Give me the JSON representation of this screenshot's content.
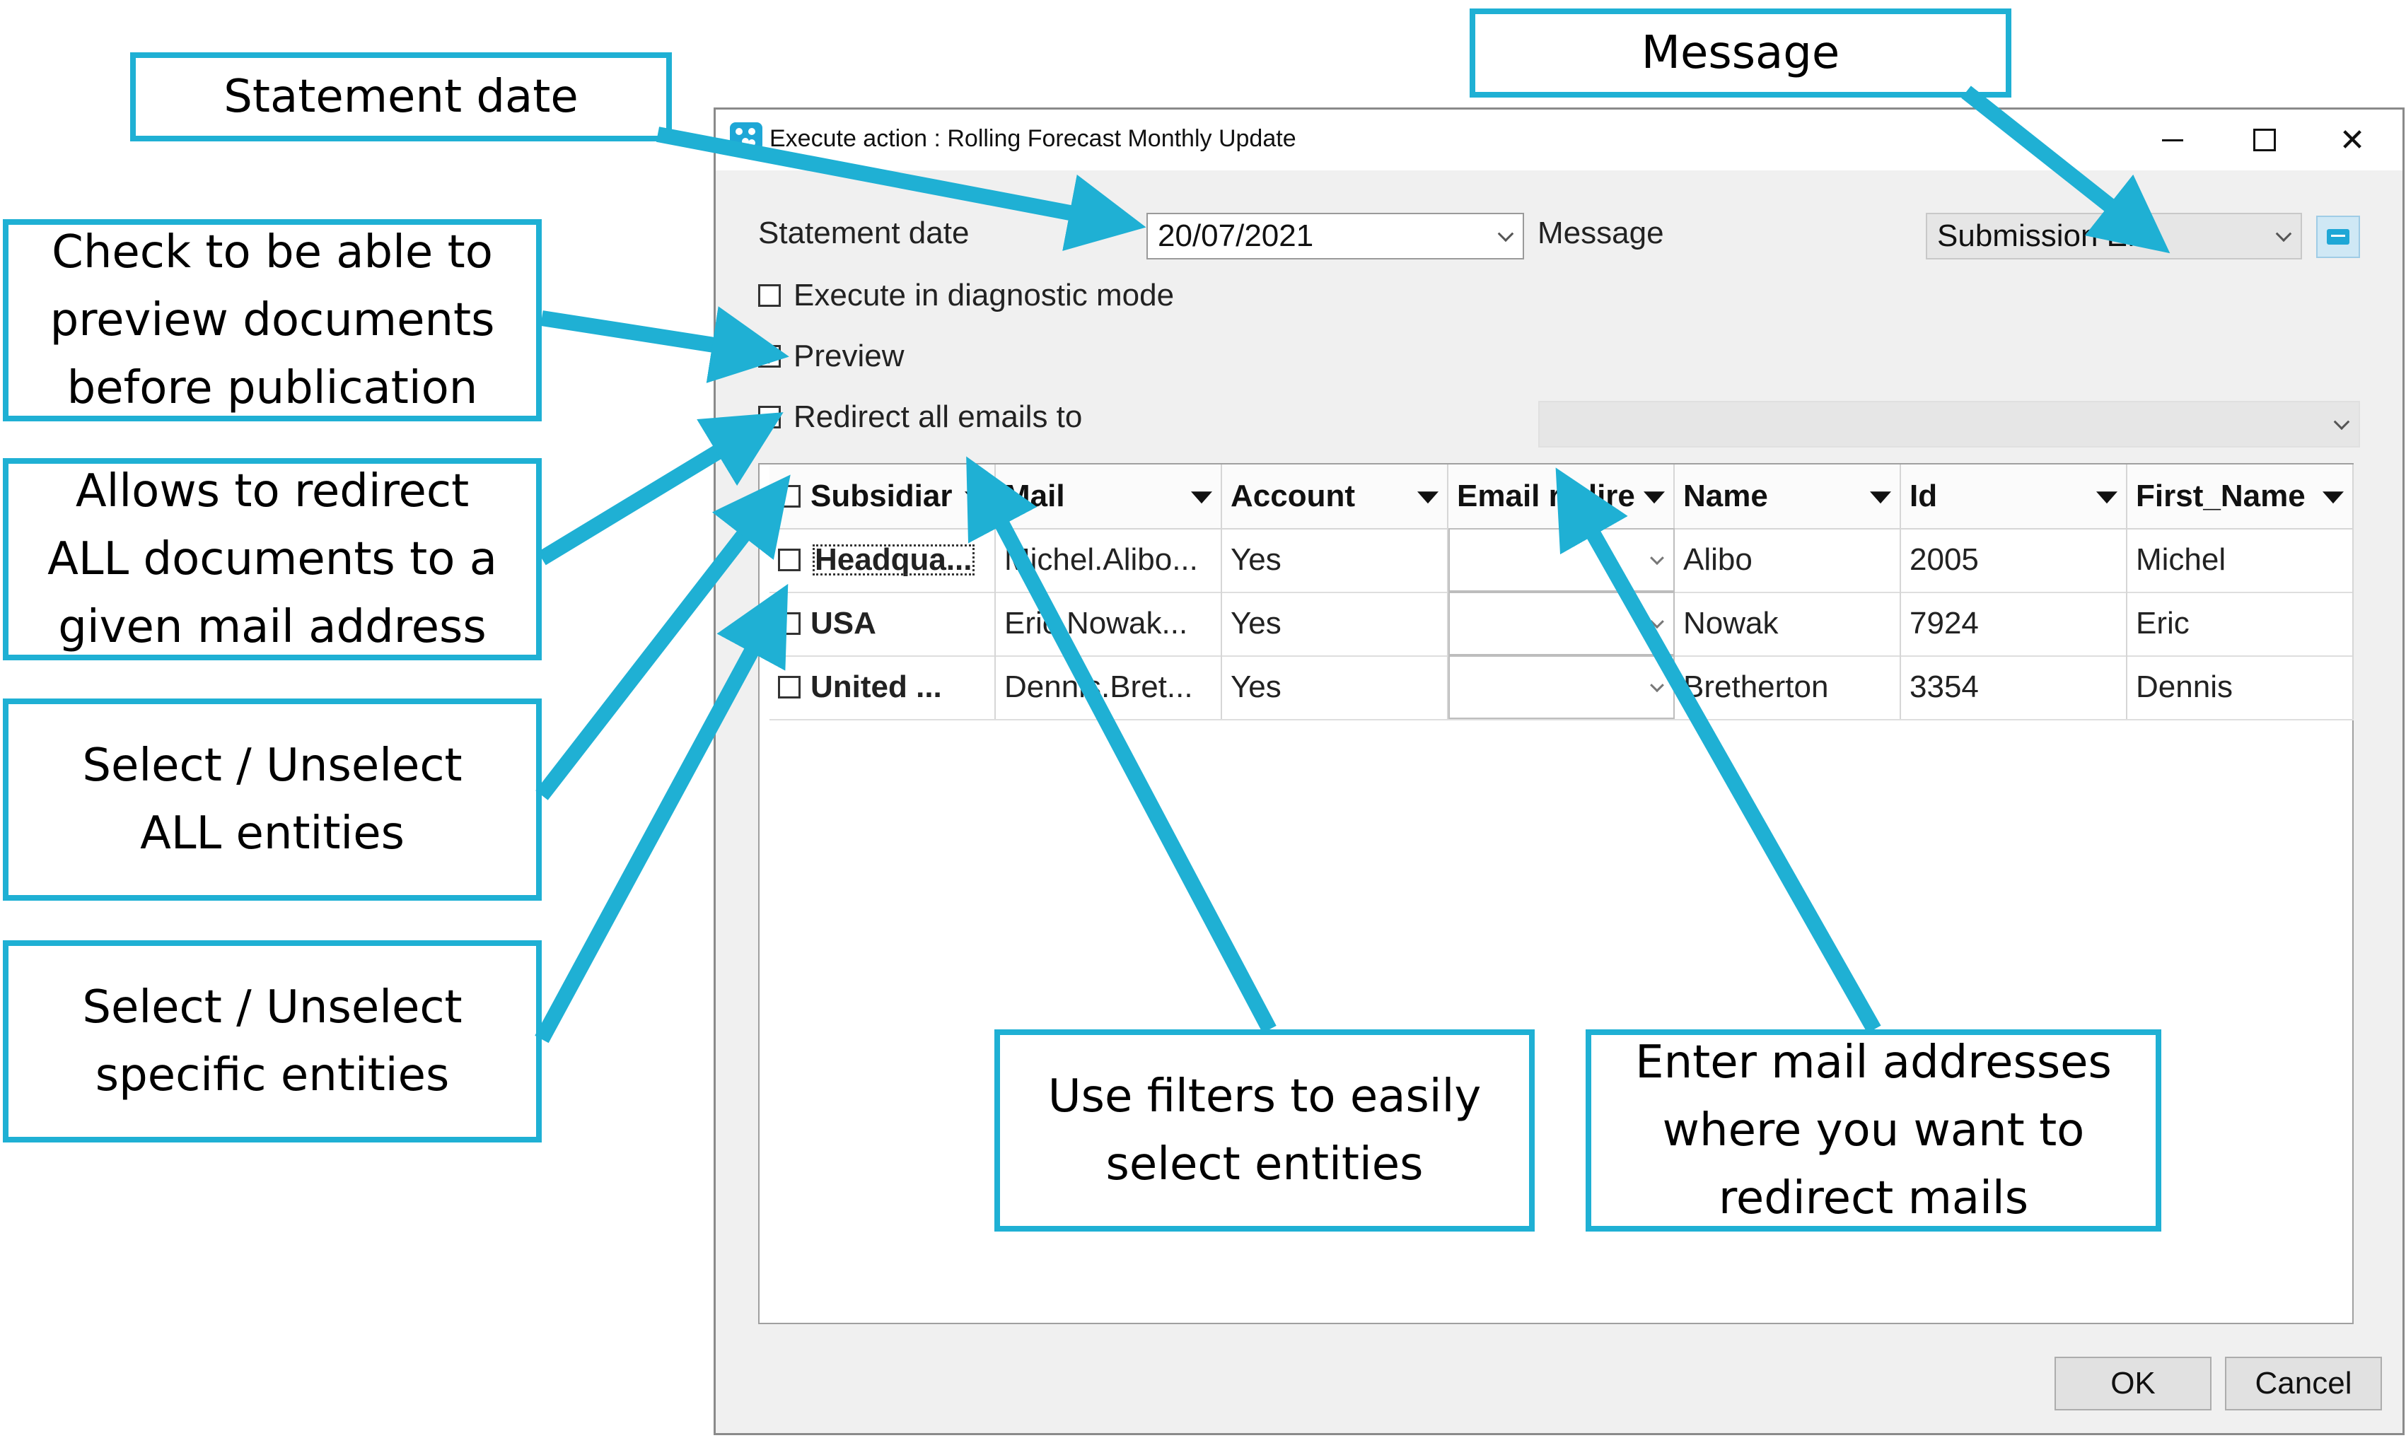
{
  "window": {
    "title": "Execute action : Rolling Forecast Monthly Update",
    "minimize_label": "",
    "close_glyph": "✕"
  },
  "form": {
    "statement_date_label": "Statement date",
    "statement_date_value": "20/07/2021",
    "message_label": "Message",
    "message_value": "Submission EN",
    "diagnostic_label": "Execute in diagnostic mode",
    "diagnostic_checked": false,
    "preview_label": "Preview",
    "preview_checked": true,
    "redirect_label": "Redirect all emails to",
    "redirect_checked": false,
    "redirect_value": ""
  },
  "grid": {
    "headers": [
      "Subsidiar",
      "Mail",
      "Account",
      "Email redire",
      "Name",
      "Id",
      "First_Name"
    ],
    "rows": [
      {
        "subsidiary": "Headqua...",
        "mail": "Michel.Alibo...",
        "account": "Yes",
        "email_redirect": "",
        "name": "Alibo",
        "id": "2005",
        "first_name": "Michel"
      },
      {
        "subsidiary": "USA",
        "mail": "Eric.Nowak...",
        "account": "Yes",
        "email_redirect": "",
        "name": "Nowak",
        "id": "7924",
        "first_name": "Eric"
      },
      {
        "subsidiary": "United ...",
        "mail": "Dennis.Bret...",
        "account": "Yes",
        "email_redirect": "",
        "name": "Bretherton",
        "id": "3354",
        "first_name": "Dennis"
      }
    ]
  },
  "buttons": {
    "ok": "OK",
    "cancel": "Cancel"
  },
  "callouts": {
    "statement_date": "Statement date",
    "message": "Message",
    "preview": "Check to be able to\npreview documents\nbefore publication",
    "redirect": "Allows to redirect\nALL documents to a\ngiven mail address",
    "select_all": "Select / Unselect\nALL entities",
    "select_specific": "Select / Unselect\nspecific entities",
    "filters": "Use filters to easily\nselect entities",
    "enter_mail": "Enter mail addresses\nwhere you want to\nredirect mails"
  },
  "colors": {
    "accent": "#1fb0d4",
    "app_icon": "#1ea7d6"
  }
}
